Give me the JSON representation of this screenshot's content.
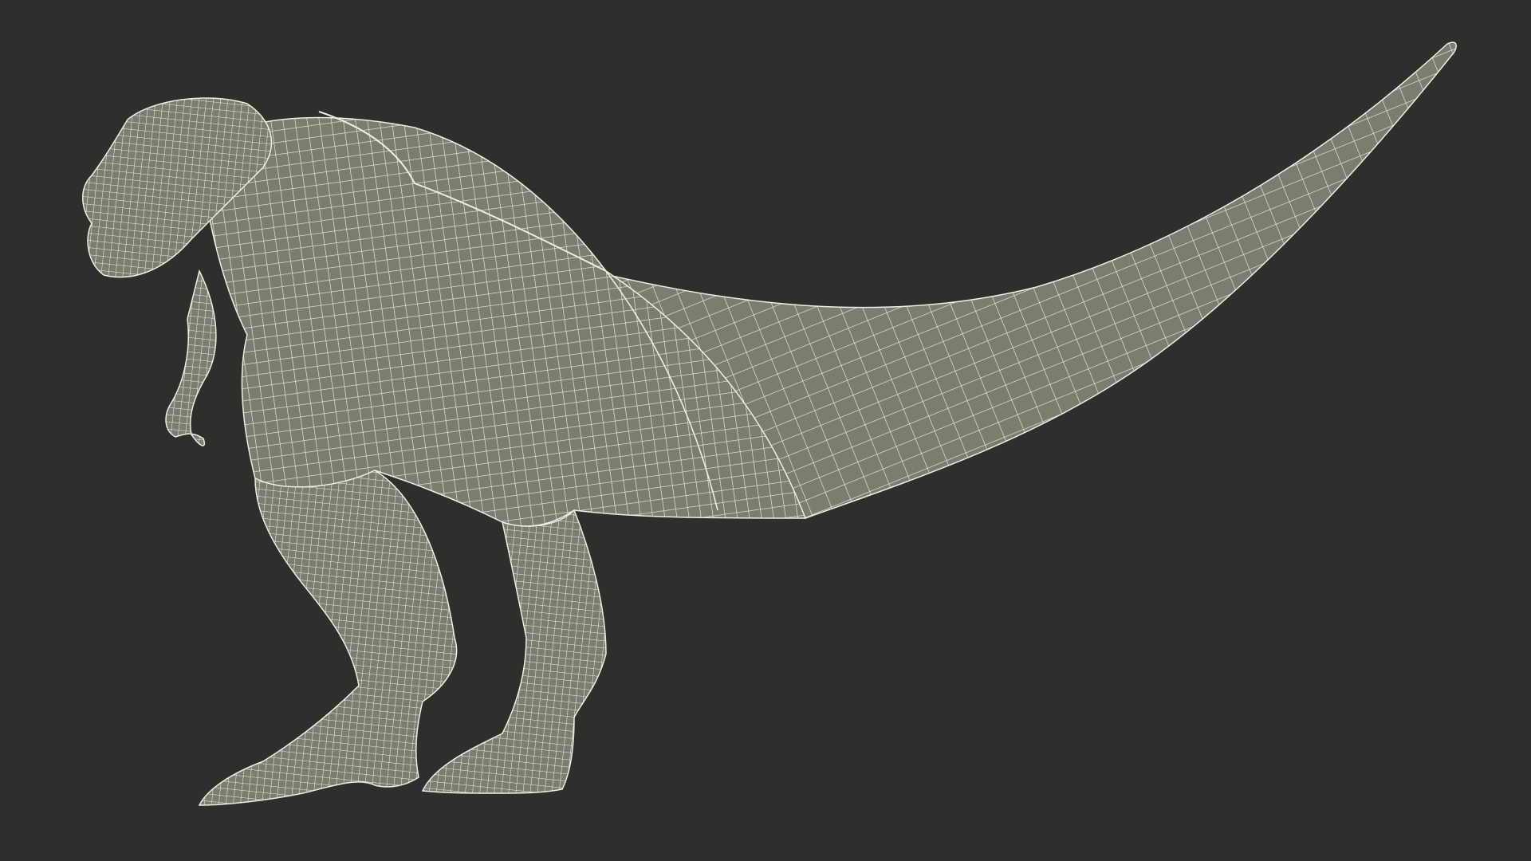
{
  "scene": {
    "subject": "wireframe-dinosaur-model",
    "background_color": "#2e2e2d",
    "mesh_fill_color": "#7c7c70",
    "mesh_shadow_color": "#6b6b60",
    "wire_color": "#efeee4"
  }
}
